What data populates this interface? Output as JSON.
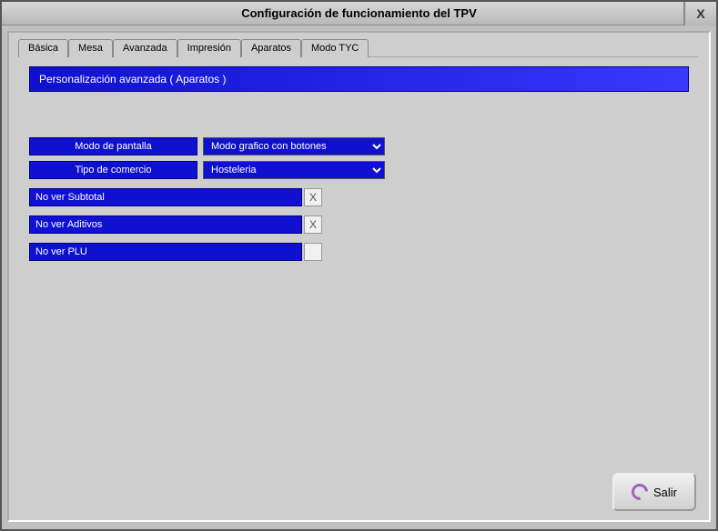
{
  "window": {
    "title": "Configuración de funcionamiento del TPV",
    "close": "X"
  },
  "tabs": {
    "basica": "Básica",
    "mesa": "Mesa",
    "avanzada": "Avanzada",
    "impresion": "Impresión",
    "aparatos": "Aparatos",
    "modo_tyc": "Modo TYC"
  },
  "panel": {
    "header": "Personalización avanzada ( Aparatos )",
    "modo_pantalla_label": "Modo de pantalla",
    "modo_pantalla_value": "Modo grafico con botones",
    "tipo_comercio_label": "Tipo de comercio",
    "tipo_comercio_value": "Hosteleria",
    "no_ver_subtotal": "No ver Subtotal",
    "no_ver_aditivos": "No ver Aditivos",
    "no_ver_plu": "No ver PLU",
    "check_x": "X",
    "check_empty": ""
  },
  "footer": {
    "salir": "Salir"
  }
}
